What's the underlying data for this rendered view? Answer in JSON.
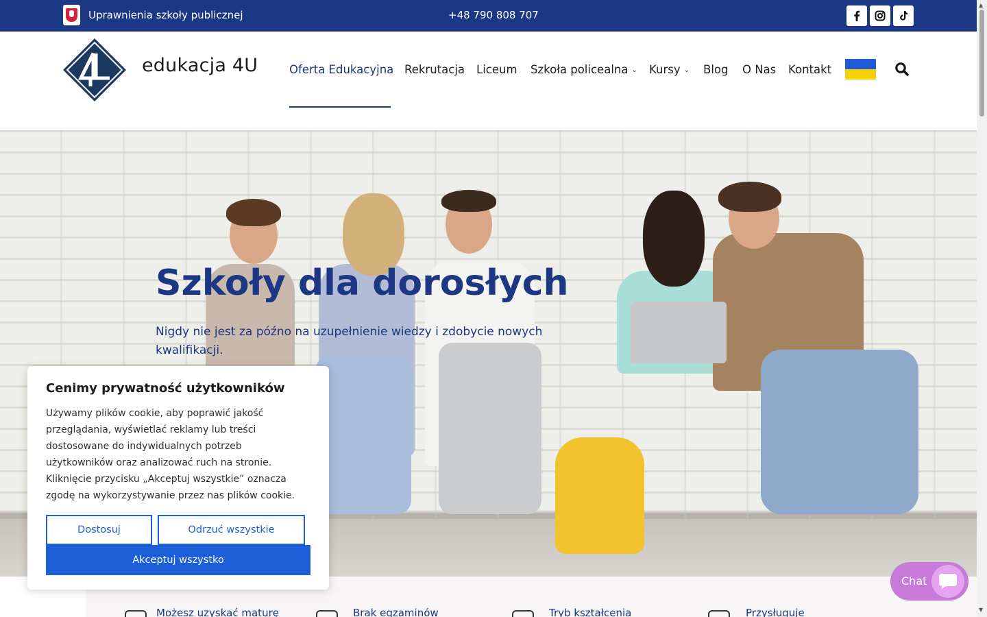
{
  "topbar": {
    "rights_text": "Uprawnienia szkoły publicznej",
    "phone": "+48 790 808 707",
    "social": [
      "facebook-icon",
      "instagram-icon",
      "tiktok-icon"
    ]
  },
  "header": {
    "logo_text": "edukacja 4U",
    "nav": [
      {
        "label": "Oferta Edukacyjna",
        "active": true,
        "dropdown": false
      },
      {
        "label": "Rekrutacja",
        "dropdown": false
      },
      {
        "label": "Liceum",
        "dropdown": false
      },
      {
        "label": "Szkoła policealna",
        "dropdown": true
      },
      {
        "label": "Kursy",
        "dropdown": true
      },
      {
        "label": "Blog",
        "dropdown": false
      },
      {
        "label": "O Nas",
        "dropdown": false
      },
      {
        "label": "Kontakt",
        "dropdown": false
      }
    ],
    "flag": "ukraine-flag",
    "search_icon": "search-icon"
  },
  "hero": {
    "title": "Szkoły dla dorosłych",
    "subtitle": "Nigdy nie jest za późno na uzupełnienie wiedzy i zdobycie nowych kwalifikacji."
  },
  "features": [
    {
      "label": "Możesz uzyskać maturę"
    },
    {
      "label": "Brak egzaminów"
    },
    {
      "label": "Tryb kształcenia"
    },
    {
      "label": "Przysługuje"
    }
  ],
  "cookie": {
    "title": "Cenimy prywatność użytkowników",
    "body": "Używamy plików cookie, aby poprawić jakość przeglądania, wyświetlać reklamy lub treści dostosowane do indywidualnych potrzeb użytkowników oraz analizować ruch na stronie. Kliknięcie przycisku „Akceptuj wszystkie” oznacza zgodę na wykorzystywanie przez nas plików cookie.",
    "customize_label": "Dostosuj",
    "reject_label": "Odrzuć wszystkie",
    "accept_label": "Akceptuj wszystko"
  },
  "chat": {
    "label": "Chat"
  },
  "colors": {
    "brand": "#1c3783",
    "cookie_button": "#1c5fd8",
    "chat": "#c87ad8"
  }
}
